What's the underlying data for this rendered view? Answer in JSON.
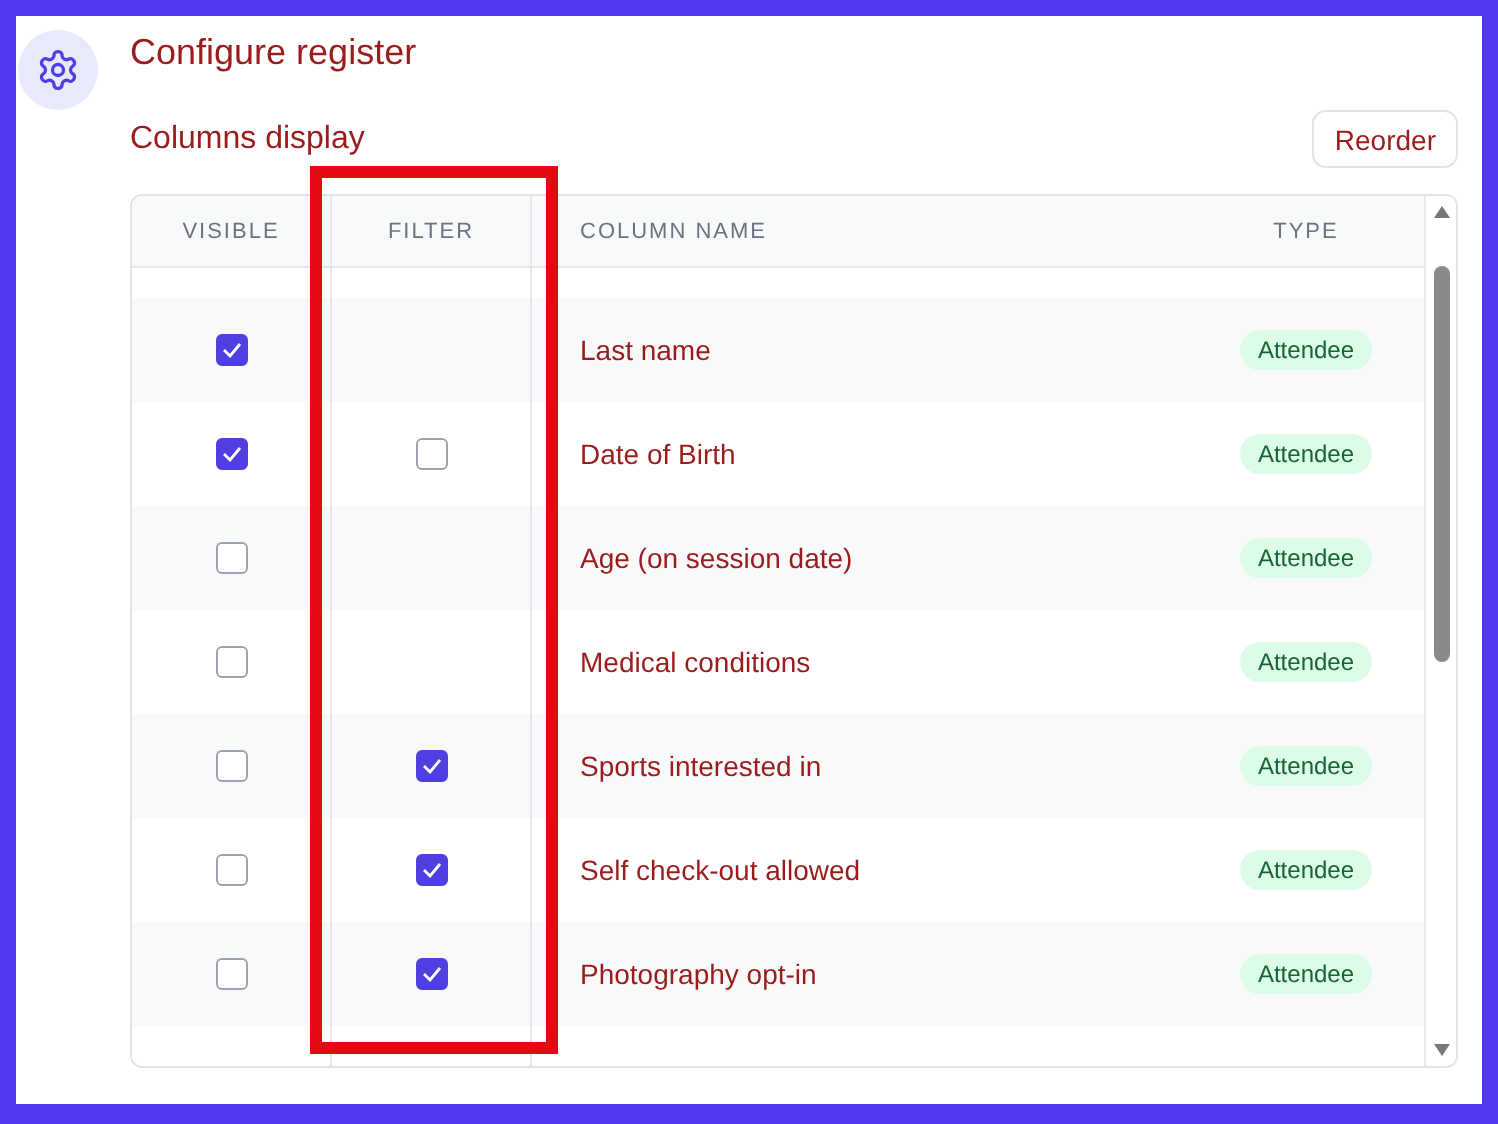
{
  "title": "Configure register",
  "section": {
    "title": "Columns display",
    "button": "Reorder"
  },
  "table": {
    "columns": [
      "VISIBLE",
      "FILTER",
      "COLUMN NAME",
      "TYPE"
    ],
    "rows": [
      {
        "visible": true,
        "name": "Last name",
        "type": "Attendee"
      },
      {
        "visible": true,
        "filter": {
          "checked": false
        },
        "name": "Date of Birth",
        "type": "Attendee"
      },
      {
        "visible": false,
        "name": "Age (on session date)",
        "type": "Attendee"
      },
      {
        "visible": false,
        "name": "Medical conditions",
        "type": "Attendee"
      },
      {
        "visible": false,
        "filter": {
          "checked": true
        },
        "name": "Sports interested in",
        "type": "Attendee"
      },
      {
        "visible": false,
        "filter": {
          "checked": true
        },
        "name": "Self check-out allowed",
        "type": "Attendee"
      },
      {
        "visible": false,
        "filter": {
          "checked": true
        },
        "name": "Photography opt-in",
        "type": "Attendee"
      }
    ]
  }
}
